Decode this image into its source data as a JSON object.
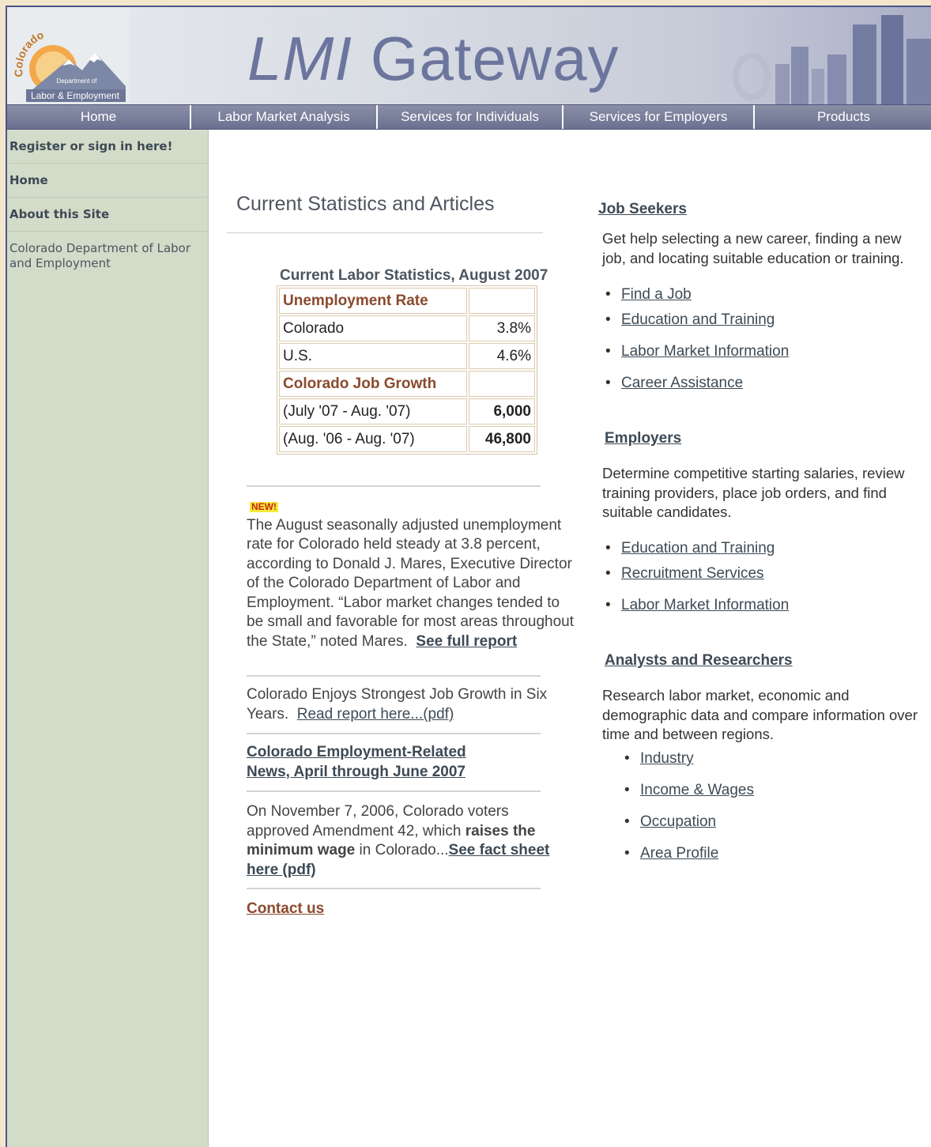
{
  "header": {
    "logo_arc_text": "Colorado",
    "logo_dept_text": "Department of",
    "logo_name_text": "Labor & Employment",
    "title_italic": "LMI",
    "title_rest": " Gateway"
  },
  "nav": {
    "items": [
      "Home",
      "Labor Market Analysis",
      "Services for Individuals",
      "Services for Employers",
      "Products"
    ]
  },
  "sidebar": {
    "register": "Register or sign in here!",
    "home": "Home",
    "about": "About this Site",
    "dept": "Colorado Department of Labor and Employment"
  },
  "main": {
    "heading": "Current Statistics and Articles",
    "stats": {
      "caption": "Current Labor Statistics, August 2007",
      "unemployment_header": "Unemployment Rate",
      "rows_unemployment": [
        {
          "label": "Colorado",
          "value": "3.8%"
        },
        {
          "label": "U.S.",
          "value": "4.6%"
        }
      ],
      "growth_header": "Colorado Job Growth",
      "rows_growth": [
        {
          "label": "(July '07 - Aug. '07)",
          "value": "6,000"
        },
        {
          "label": "(Aug. '06 - Aug. '07)",
          "value": "46,800"
        }
      ]
    },
    "new_badge": "NEW!",
    "article1_text": "The August seasonally adjusted unemployment rate for Colorado held steady at 3.8 percent, according to Donald J. Mares, Executive Director of the Colorado Department of Labor and Employment.  “Labor market changes tended to be small and favorable for most areas throughout the State,” noted Mares.",
    "article1_link": "See full report",
    "article2_text": "Colorado Enjoys Strongest Job Growth in Six Years.",
    "article2_link": "Read report here...(pdf)",
    "article3_link_line1": "Colorado Employment-Related",
    "article3_link_line2": "News, April through June 2007",
    "article4_text_a": "On November 7, 2006, Colorado voters approved Amendment 42, which ",
    "article4_bold": "raises the minimum wage",
    "article4_text_b": " in Colorado...",
    "article4_link": "See fact sheet here (pdf)",
    "contact": "Contact us"
  },
  "right": {
    "job_seekers": {
      "heading": "Job Seekers",
      "desc_line1": "Get help selecting a new career, finding a new",
      "desc_line2": "job, and locating suitable education or training.",
      "links": [
        "Find a Job",
        "Education and Training",
        "Labor Market Information",
        "Career Assistance"
      ]
    },
    "employers": {
      "heading": "Employers",
      "desc_line1": "Determine competitive starting salaries, review",
      "desc_line2": "training providers, place job orders, and find",
      "desc_line3": "suitable candidates.",
      "links": [
        "Education and Training",
        "Recruitment Services",
        "Labor Market Information"
      ]
    },
    "analysts": {
      "heading": "Analysts and Researchers",
      "desc_line1": "Research labor market, economic and",
      "desc_line2": "demographic data and compare information over",
      "desc_line3": "time and between regions.",
      "links": [
        "Industry",
        "Income & Wages",
        "Occupation",
        "Area Profile"
      ]
    }
  }
}
